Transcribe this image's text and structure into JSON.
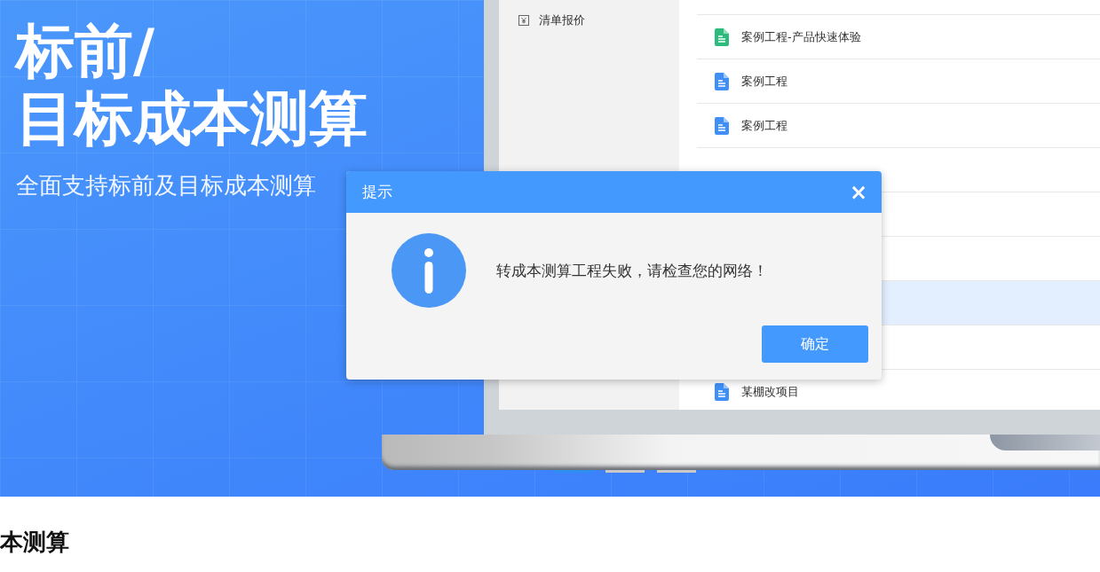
{
  "hero": {
    "title_lines": [
      "标前/",
      "目标成本测算"
    ],
    "subtitle": "全面支持标前及目标成本测算"
  },
  "app": {
    "sidebar": {
      "items": [
        {
          "label": "清单报价"
        }
      ]
    },
    "list": [
      {
        "kind": "green",
        "name": "案例工程-产品快速体验",
        "selected": false
      },
      {
        "kind": "blue",
        "name": "案例工程",
        "selected": false
      },
      {
        "kind": "blue",
        "name": "案例工程",
        "selected": false
      },
      {
        "kind": "blank",
        "selected": false
      },
      {
        "kind": "blank",
        "selected": false
      },
      {
        "kind": "blank",
        "selected": false
      },
      {
        "kind": "blank",
        "selected": true
      },
      {
        "kind": "blank",
        "selected": false
      },
      {
        "kind": "blue",
        "name": "某棚改项目",
        "selected": false
      }
    ]
  },
  "carousel": [
    {
      "selected": true
    },
    {
      "selected": false
    },
    {
      "selected": false
    }
  ],
  "section_heading": "本测算",
  "dialog": {
    "title": "提示",
    "close": "×",
    "message": "转成本测算工程失败，请检查您的网络！",
    "button": "确定"
  }
}
